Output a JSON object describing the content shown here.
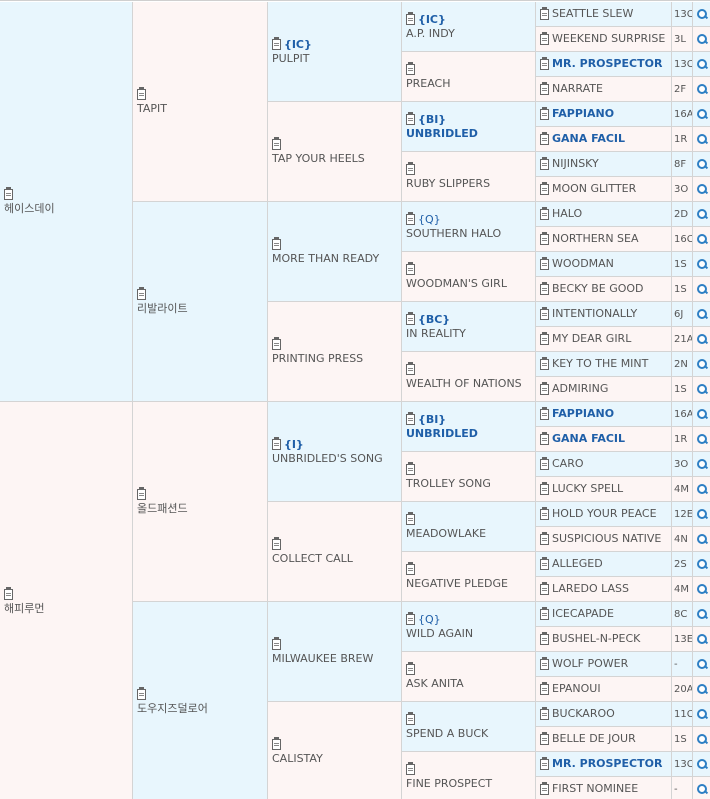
{
  "pedigree": {
    "gen1": [
      {
        "name": "헤이스데이"
      },
      {
        "name": "해피루먼"
      }
    ],
    "gen2": [
      {
        "name": "TAPIT"
      },
      {
        "name": "리발라이트"
      },
      {
        "name": "올드패션드"
      },
      {
        "name": "도우지즈덜로어"
      }
    ],
    "gen3": [
      {
        "tag": "{IC}",
        "name": "PULPIT"
      },
      {
        "tag": "",
        "name": "TAP YOUR HEELS"
      },
      {
        "tag": "",
        "name": "MORE THAN READY"
      },
      {
        "tag": "",
        "name": "PRINTING PRESS"
      },
      {
        "tag": "{I}",
        "name": "UNBRIDLED'S SONG"
      },
      {
        "tag": "",
        "name": "COLLECT CALL"
      },
      {
        "tag": "",
        "name": "MILWAUKEE BREW"
      },
      {
        "tag": "",
        "name": "CALISTAY"
      }
    ],
    "gen4": [
      {
        "tag": "{IC}",
        "name": "A.P. INDY",
        "highlight": false
      },
      {
        "tag": "",
        "name": "PREACH",
        "highlight": false
      },
      {
        "tag": "{BI}",
        "name": "UNBRIDLED",
        "highlight": true
      },
      {
        "tag": "",
        "name": "RUBY SLIPPERS",
        "highlight": false
      },
      {
        "tag": "{Q}",
        "name": "SOUTHERN HALO",
        "highlight": false
      },
      {
        "tag": "",
        "name": "WOODMAN'S GIRL",
        "highlight": false
      },
      {
        "tag": "{BC}",
        "name": "IN REALITY",
        "highlight": false
      },
      {
        "tag": "",
        "name": "WEALTH OF NATIONS",
        "highlight": false
      },
      {
        "tag": "{BI}",
        "name": "UNBRIDLED",
        "highlight": true
      },
      {
        "tag": "",
        "name": "TROLLEY SONG",
        "highlight": false
      },
      {
        "tag": "",
        "name": "MEADOWLAKE",
        "highlight": false
      },
      {
        "tag": "",
        "name": "NEGATIVE PLEDGE",
        "highlight": false
      },
      {
        "tag": "{Q}",
        "name": "WILD AGAIN",
        "highlight": false
      },
      {
        "tag": "",
        "name": "ASK ANITA",
        "highlight": false
      },
      {
        "tag": "",
        "name": "SPEND A BUCK",
        "highlight": false
      },
      {
        "tag": "",
        "name": "FINE PROSPECT",
        "highlight": false
      }
    ],
    "gen5": [
      {
        "name": "SEATTLE SLEW",
        "code": "13C",
        "highlight": false
      },
      {
        "name": "WEEKEND SURPRISE",
        "code": "3L",
        "highlight": false
      },
      {
        "name": "MR. PROSPECTOR",
        "code": "13C",
        "highlight": true
      },
      {
        "name": "NARRATE",
        "code": "2F",
        "highlight": false
      },
      {
        "name": "FAPPIANO",
        "code": "16A",
        "highlight": true
      },
      {
        "name": "GANA FACIL",
        "code": "1R",
        "highlight": true
      },
      {
        "name": "NIJINSKY",
        "code": "8F",
        "highlight": false
      },
      {
        "name": "MOON GLITTER",
        "code": "3O",
        "highlight": false
      },
      {
        "name": "HALO",
        "code": "2D",
        "highlight": false
      },
      {
        "name": "NORTHERN SEA",
        "code": "16C",
        "highlight": false
      },
      {
        "name": "WOODMAN",
        "code": "1S",
        "highlight": false
      },
      {
        "name": "BECKY BE GOOD",
        "code": "1S",
        "highlight": false
      },
      {
        "name": "INTENTIONALLY",
        "code": "6J",
        "highlight": false
      },
      {
        "name": "MY DEAR GIRL",
        "code": "21A",
        "highlight": false
      },
      {
        "name": "KEY TO THE MINT",
        "code": "2N",
        "highlight": false
      },
      {
        "name": "ADMIRING",
        "code": "1S",
        "highlight": false
      },
      {
        "name": "FAPPIANO",
        "code": "16A",
        "highlight": true
      },
      {
        "name": "GANA FACIL",
        "code": "1R",
        "highlight": true
      },
      {
        "name": "CARO",
        "code": "3O",
        "highlight": false
      },
      {
        "name": "LUCKY SPELL",
        "code": "4M",
        "highlight": false
      },
      {
        "name": "HOLD YOUR PEACE",
        "code": "12E",
        "highlight": false
      },
      {
        "name": "SUSPICIOUS NATIVE",
        "code": "4N",
        "highlight": false
      },
      {
        "name": "ALLEGED",
        "code": "2S",
        "highlight": false
      },
      {
        "name": "LAREDO LASS",
        "code": "4M",
        "highlight": false
      },
      {
        "name": "ICECAPADE",
        "code": "8C",
        "highlight": false
      },
      {
        "name": "BUSHEL-N-PECK",
        "code": "13E",
        "highlight": false
      },
      {
        "name": "WOLF POWER",
        "code": "-",
        "highlight": false
      },
      {
        "name": "EPANOUI",
        "code": "20A",
        "highlight": false
      },
      {
        "name": "BUCKAROO",
        "code": "11C",
        "highlight": false
      },
      {
        "name": "BELLE DE JOUR",
        "code": "1S",
        "highlight": false
      },
      {
        "name": "MR. PROSPECTOR",
        "code": "13C",
        "highlight": true
      },
      {
        "name": "FIRST NOMINEE",
        "code": "-",
        "highlight": false
      }
    ]
  },
  "icons": {
    "info": "clipboard-icon",
    "search": "search-icon"
  },
  "colors": {
    "sire_bg": "#e8f6fd",
    "dam_bg": "#fdf5f4",
    "highlight_text": "#1f5fa8"
  }
}
